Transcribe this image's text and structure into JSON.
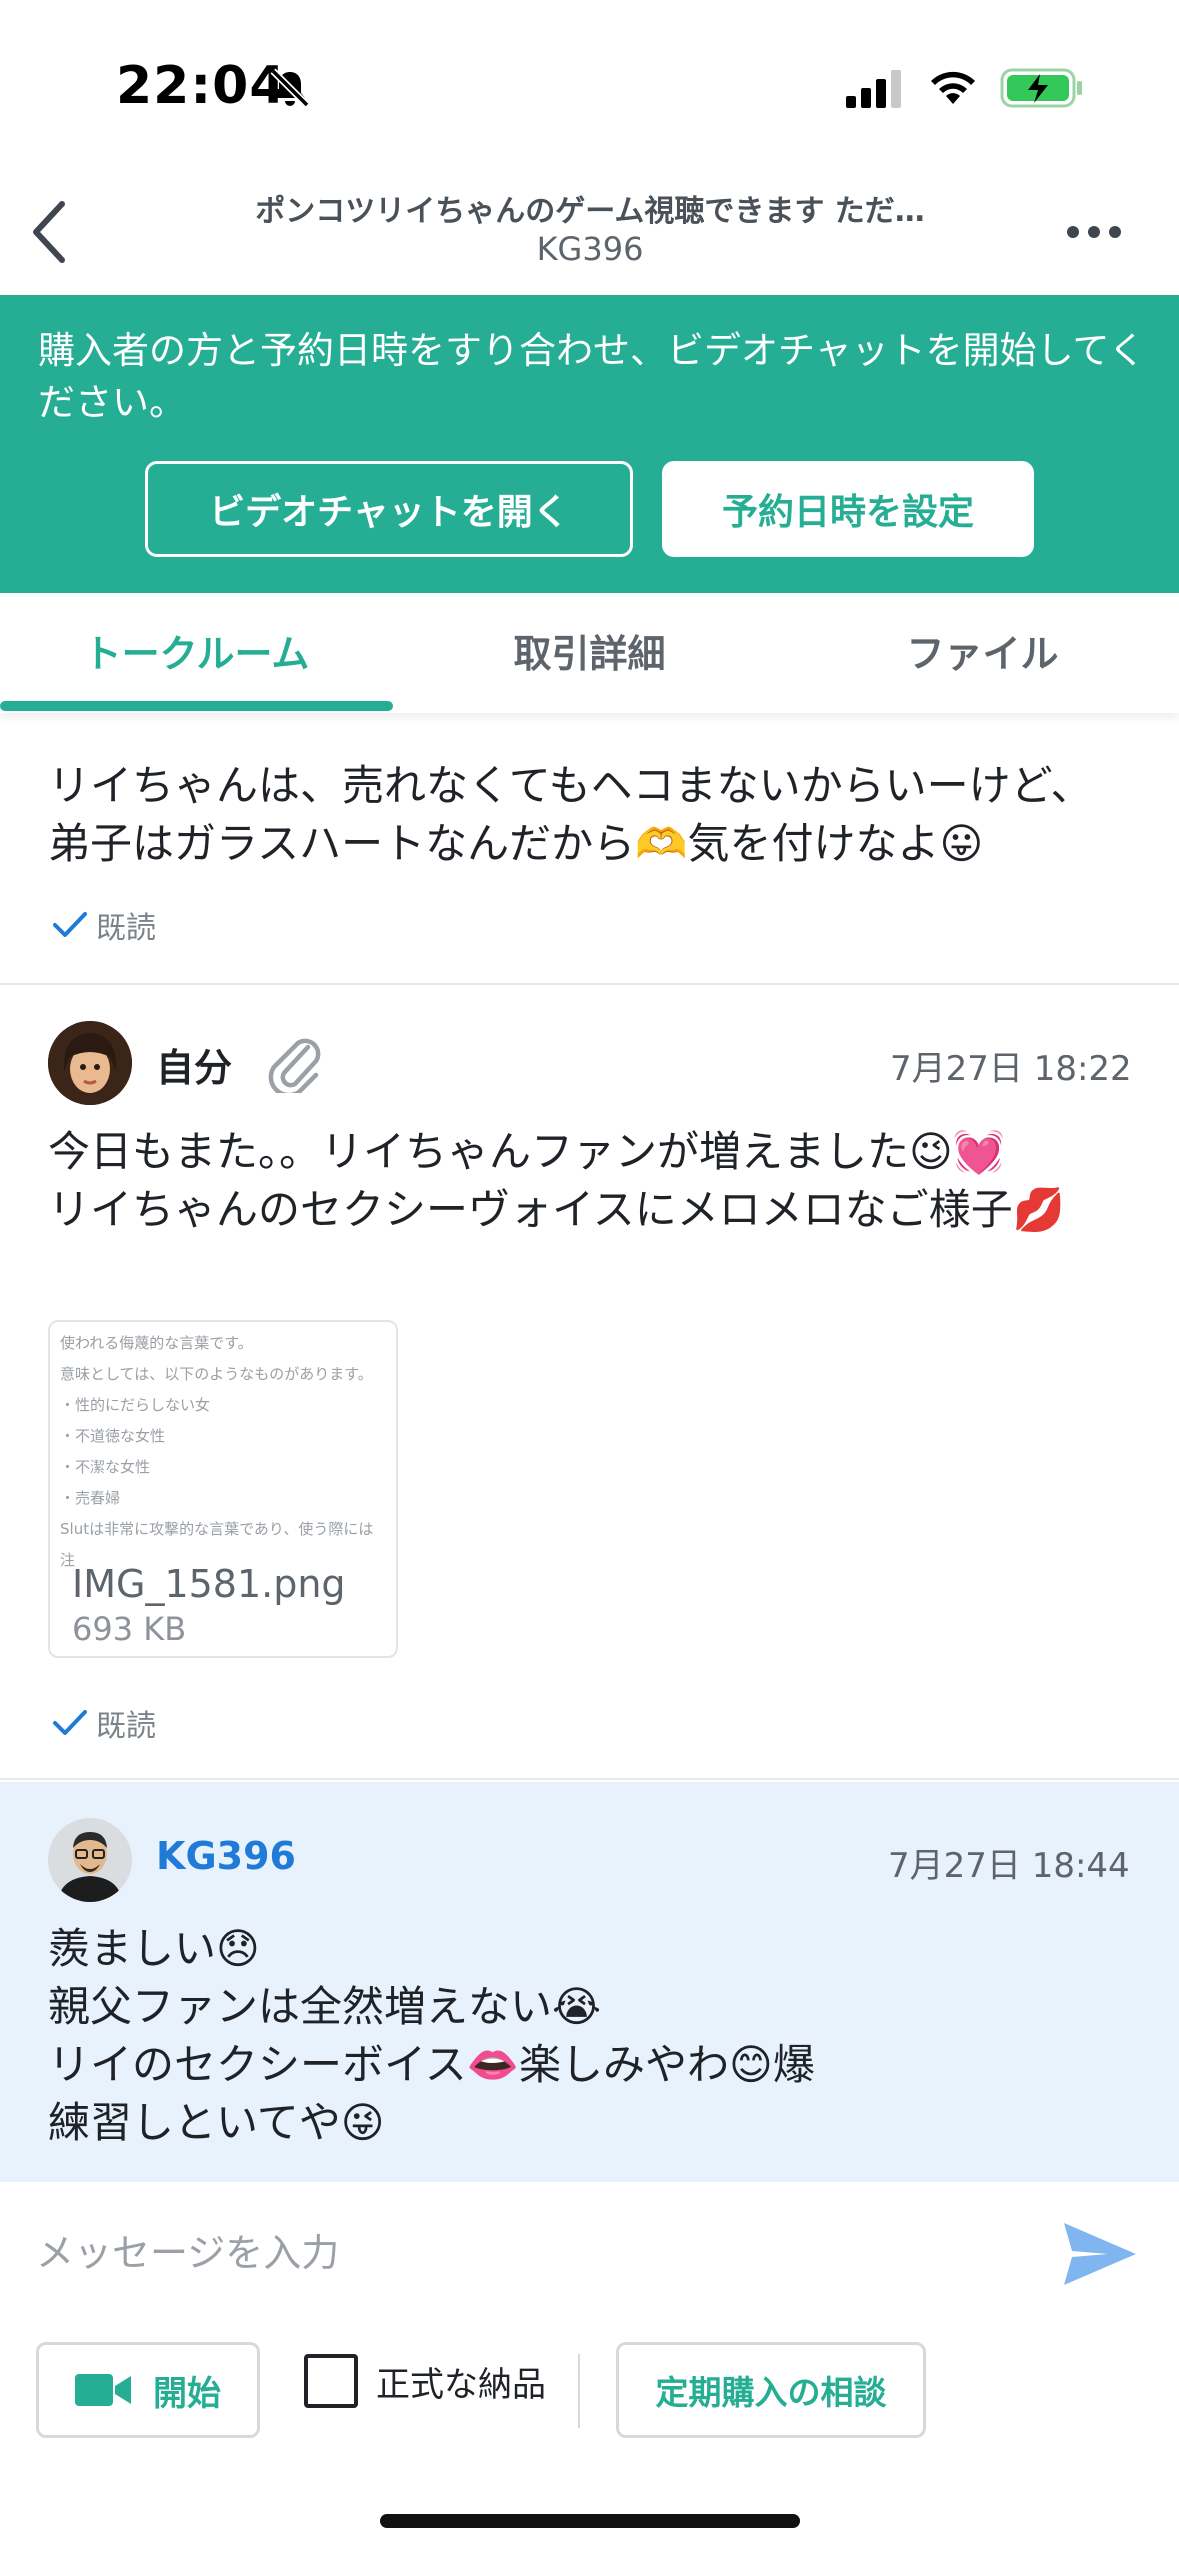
{
  "status_bar": {
    "time": "22:04"
  },
  "header": {
    "title": "ポンコツリイちゃんのゲーム視聴できます ただ…",
    "subtitle": "KG396"
  },
  "banner": {
    "text": "購入者の方と予約日時をすり合わせ、ビデオチャットを開始してください。",
    "video_button": "ビデオチャットを開く",
    "reserve_button": "予約日時を設定",
    "bg_color": "#26ae94"
  },
  "tabs": [
    {
      "label": "トークルーム",
      "active": true
    },
    {
      "label": "取引詳細",
      "active": false
    },
    {
      "label": "ファイル",
      "active": false
    }
  ],
  "messages": {
    "partial": {
      "lines": [
        "リイちゃんは、売れなくてもヘコまないからいーけど、",
        "弟子はガラスハートなんだから🫶気を付けなよ😛"
      ],
      "read_label": "既読"
    },
    "self": {
      "sender": "自分",
      "time": "7月27日 18:22",
      "lines": [
        "今日もまた。。リイちゃんファンが増えました😉💓",
        "リイちゃんのセクシーヴォイスにメロメロなご様子💋"
      ],
      "attachment": {
        "thumb_lines": [
          "使われる侮蔑的な言葉です。",
          "意味としては、以下のようなものがあります。",
          "・性的にだらしない女",
          "・不道徳な女性",
          "・不潔な女性",
          "・売春婦",
          "Slutは非常に攻撃的な言葉であり、使う際には注"
        ],
        "file_name": "IMG_1581.png",
        "file_size": "693 KB"
      },
      "read_label": "既読"
    },
    "other": {
      "sender": "KG396",
      "sender_color": "#1f7ad8",
      "time": "7月27日 18:44",
      "lines": [
        "羨ましい😞",
        "親父ファンは全然増えない😭",
        "リイのセクシーボイス👄楽しみやわ😊爆",
        "練習しといてや😜"
      ]
    }
  },
  "composer": {
    "placeholder": "メッセージを入力",
    "start_button": "開始",
    "formal_delivery_label": "正式な納品",
    "formal_delivery_checked": false,
    "consult_button": "定期購入の相談"
  }
}
